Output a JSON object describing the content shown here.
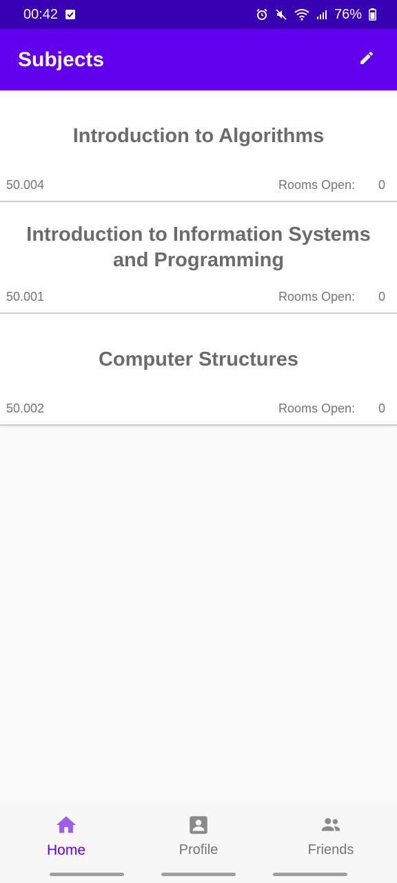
{
  "status_bar": {
    "time": "00:42",
    "battery": "76%",
    "icons": [
      "checkbox-notification-icon",
      "alarm-icon",
      "mute-icon",
      "wifi-icon",
      "signal-icon",
      "battery-icon"
    ]
  },
  "app_bar": {
    "title": "Subjects",
    "edit_icon": "pencil-icon",
    "background": "#6200ee",
    "status_background": "#3700b3"
  },
  "subjects": [
    {
      "title": "Introduction to Algorithms",
      "code": "50.004",
      "rooms_label": "Rooms Open:",
      "rooms_open": "0"
    },
    {
      "title": "Introduction to Information Systems and Programming",
      "code": "50.001",
      "rooms_label": "Rooms Open:",
      "rooms_open": "0"
    },
    {
      "title": "Computer Structures",
      "code": "50.002",
      "rooms_label": "Rooms Open:",
      "rooms_open": "0"
    }
  ],
  "bottom_nav": {
    "items": [
      {
        "label": "Home",
        "icon": "home-icon",
        "active": true
      },
      {
        "label": "Profile",
        "icon": "profile-icon",
        "active": false
      },
      {
        "label": "Friends",
        "icon": "friends-icon",
        "active": false
      }
    ],
    "active_color": "#6200ee",
    "inactive_color": "#757575"
  }
}
